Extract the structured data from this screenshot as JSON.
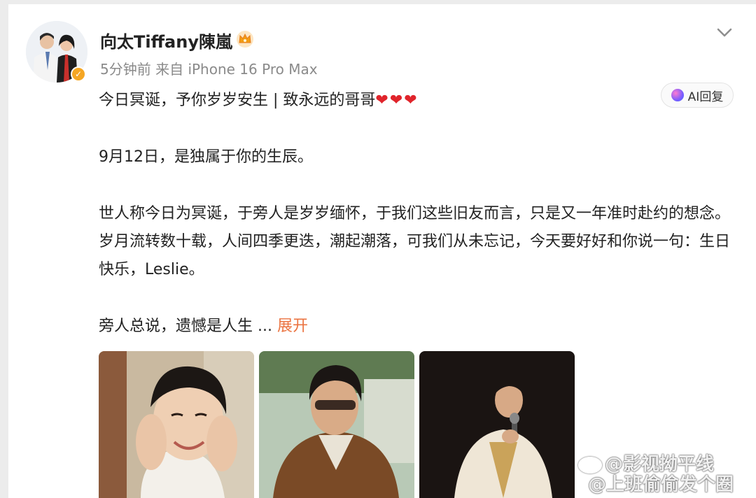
{
  "post": {
    "author": {
      "name": "向太Tiffany陳嵐",
      "verified_icon": "verified-badge-icon",
      "vip_icon": "crown-icon",
      "meta": "5分钟前  来自 iPhone 16 Pro Max"
    },
    "ai_reply_label": "AI回复",
    "line1_text": "今日冥诞，予你岁岁安生 | 致永远的哥哥",
    "line1_hearts": "❤❤❤",
    "para2": "9月12日，是独属于你的生辰。",
    "para3": "世人称今日为冥诞，于旁人是岁岁缅怀，于我们这些旧友而言，只是又一年准时赴约的想念。岁月流转数十载，人间四季更迭，潮起潮落，可我们从未忘记，今天要好好和你说一句：生日快乐，Leslie。",
    "para4": "旁人总说，遗憾是人生 ...",
    "expand_label": "展开"
  },
  "watermark": {
    "line1": "@影视拗平线",
    "line2": "@上班偷偷发个圈"
  },
  "colors": {
    "accent_link": "#eb7340",
    "heart": "#e0242b",
    "meta_gray": "#8a8a8a"
  }
}
